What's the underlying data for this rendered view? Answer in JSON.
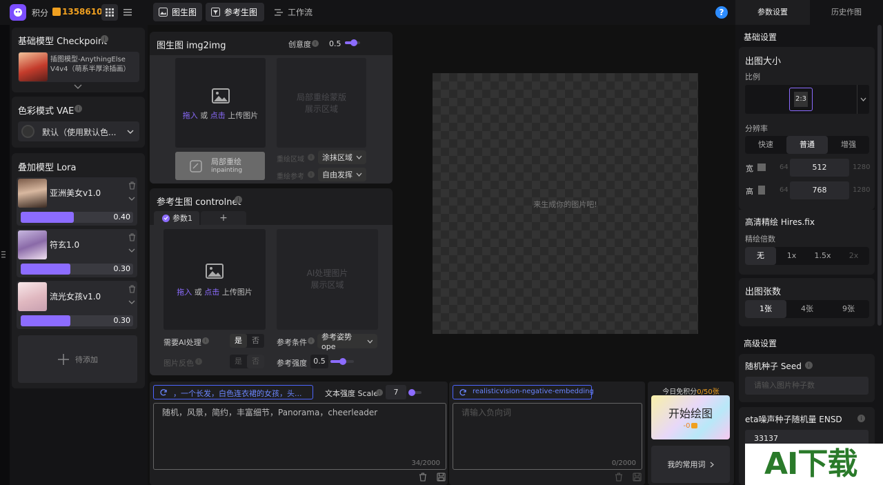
{
  "topbar": {
    "points_label": "积分",
    "points_value": "1358610",
    "tabs": [
      "图生图",
      "参考生图",
      "工作流"
    ],
    "help": "?"
  },
  "left": {
    "checkpoint": {
      "title": "基础模型 Checkpoint",
      "model_name": "插图模型-AnythingElse V4v4（萌系半厚涂插画）"
    },
    "vae": {
      "title": "色彩模式 VAE",
      "value": "默认（使用默认色..."
    },
    "lora": {
      "title": "叠加模型 Lora",
      "items": [
        {
          "name": "亚洲美女v1.0",
          "weight": "0.40",
          "level": 0.4
        },
        {
          "name": "符玄1.0",
          "weight": "0.30",
          "level": 0.3
        },
        {
          "name": "流光女孩v1.0",
          "weight": "0.30",
          "level": 0.3
        }
      ],
      "add_label": "待添加"
    }
  },
  "img2img": {
    "title": "图生图 img2img",
    "creativity_label": "创意度",
    "creativity_value": "0.5",
    "upload_drag": "拖入",
    "upload_or": "或",
    "upload_click": "点击",
    "upload_tail": "上传图片",
    "mask_area": "局部重绘蒙版\n展示区域",
    "inpaint_label": "局部重绘",
    "inpaint_sub": "inpainting",
    "redraw_area_label": "重绘区域",
    "redraw_area_value": "涂抹区域",
    "redraw_ref_label": "重绘参考",
    "redraw_ref_value": "自由发挥"
  },
  "controlnet": {
    "title": "参考生图 controlnet",
    "tab1": "参数1",
    "tab_add": "+",
    "upload_drag": "拖入",
    "upload_or": "或",
    "upload_click": "点击",
    "upload_tail": "上传图片",
    "ai_area": "AI处理图片\n展示区域",
    "ai_process_label": "需要AI处理",
    "yes": "是",
    "no": "否",
    "invert_label": "图片反色",
    "ref_cond_label": "参考条件",
    "ref_cond_value": "参考姿势 ope",
    "ref_strength_label": "参考强度",
    "ref_strength_value": "0.5"
  },
  "canvas": {
    "placeholder": "来生成你的图片吧!"
  },
  "prompt": {
    "tag": "，一个长发，白色连衣裙的女孩，头...",
    "scale_label": "文本强度 Scale",
    "scale_value": "7",
    "text": "随机，风景，简约，丰富细节，Panorama，cheerleader",
    "count": "34/2000"
  },
  "negative": {
    "tag": "realisticvision-negative-embedding",
    "placeholder": "请输入负向词",
    "count": "0/2000"
  },
  "generate": {
    "free_label": "今日免积分",
    "free_value": "0",
    "free_total": "/50张",
    "button": "开始绘图",
    "cost": "-0",
    "common_words": "我的常用词"
  },
  "right": {
    "tabs": [
      "参数设置",
      "历史作图"
    ],
    "basic_title": "基础设置",
    "size_title": "出图大小",
    "ratio_label": "比例",
    "ratio_value": "2:3",
    "res_label": "分辨率",
    "res_options": [
      "快速",
      "普通",
      "增强"
    ],
    "width_label": "宽",
    "width_min": "64",
    "width_value": "512",
    "width_max": "1280",
    "height_label": "高",
    "height_min": "64",
    "height_value": "768",
    "height_max": "1280",
    "hires_title": "高清精绘 Hires.fix",
    "hires_label": "精绘倍数",
    "hires_options": [
      "无",
      "1x",
      "1.5x",
      "2x"
    ],
    "count_title": "出图张数",
    "count_options": [
      "1张",
      "4张",
      "9张"
    ],
    "adv_title": "高级设置",
    "seed_title": "随机种子 Seed",
    "seed_placeholder": "请输入图片种子数",
    "ensd_title": "eta噪声种子随机量 ENSD",
    "ensd_value": "33137"
  },
  "watermark": {
    "text": "AI下载"
  }
}
